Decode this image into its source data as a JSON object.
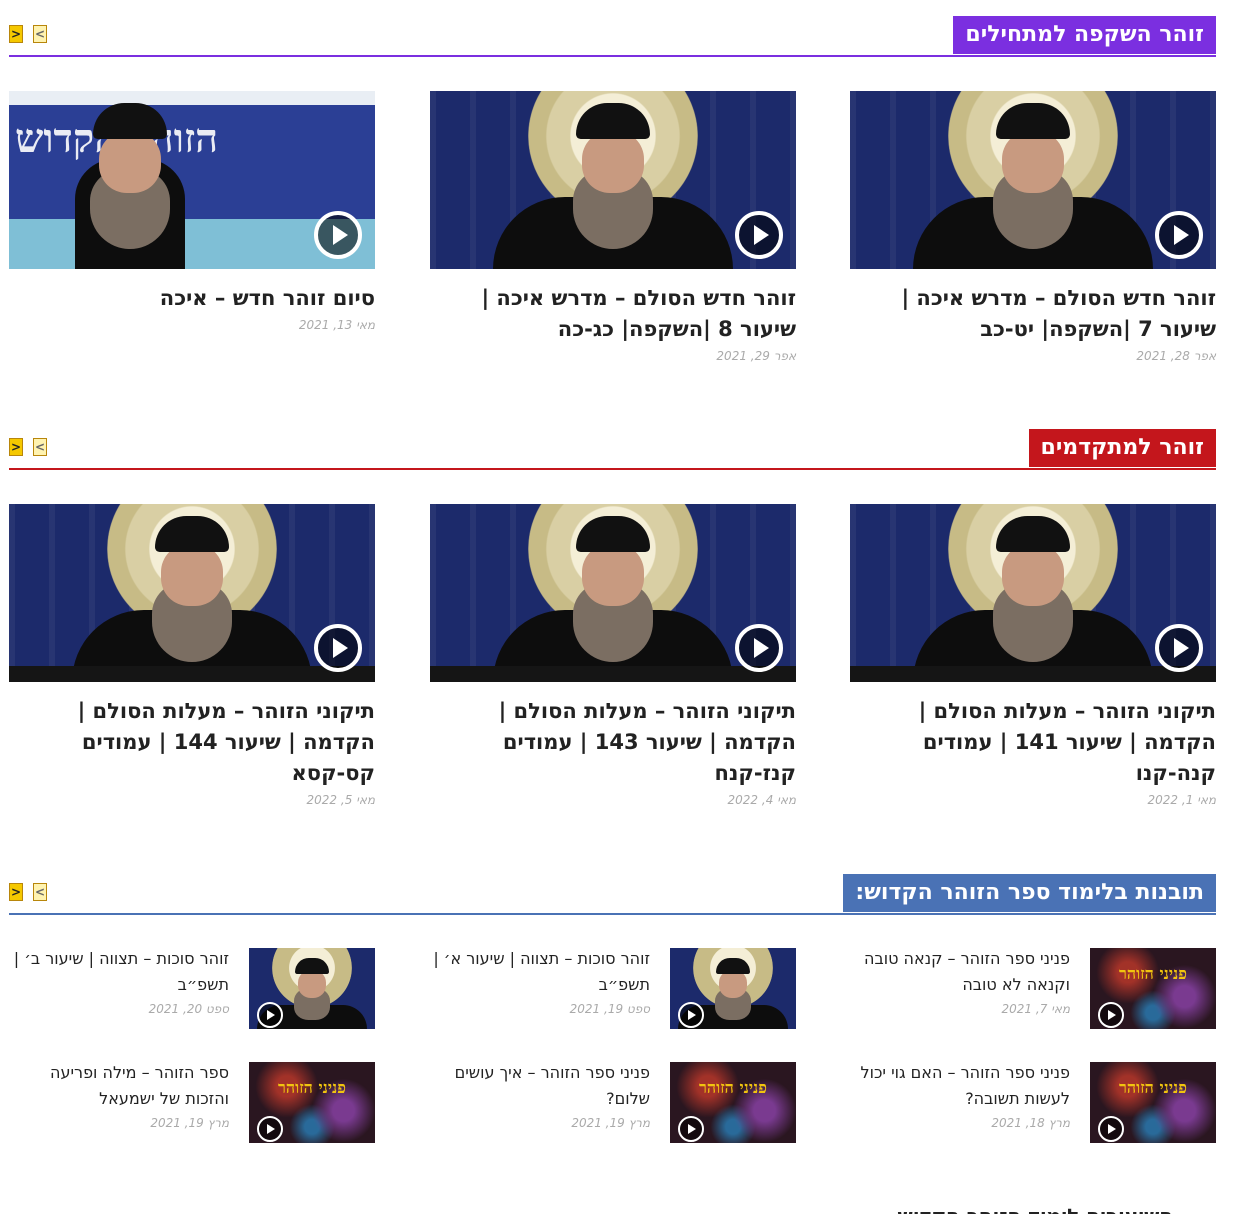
{
  "sections": [
    {
      "title": "זוהר השקפה למתחילים",
      "color": "#7b2fe0",
      "prev_icon": "chevron-left-icon",
      "next_icon": "chevron-right-icon",
      "cards": [
        {
          "title": "זוהר חדש הסולם – מדרש איכה | שיעור 7 |השקפה| יט-כב",
          "date": "אפר 28, 2021"
        },
        {
          "title": "זוהר חדש הסולם – מדרש איכה | שיעור 8 |השקפה| כג-כה",
          "date": "אפר 29, 2021"
        },
        {
          "title": "סיום זוהר חדש – איכה",
          "date": "מאי 13, 2021",
          "banner": "הזוהר הקדוש"
        }
      ]
    },
    {
      "title": "זוהר למתקדמים",
      "color": "#c4161c",
      "cards": [
        {
          "title": "תיקוני הזוהר – מעלות הסולם | הקדמה | שיעור 141 | עמודים קנה-קנו",
          "date": "מאי 1, 2022"
        },
        {
          "title": "תיקוני הזוהר – מעלות הסולם | הקדמה | שיעור 143 | עמודים קנז-קנח",
          "date": "מאי 4, 2022"
        },
        {
          "title": "תיקוני הזוהר – מעלות הסולם | הקדמה | שיעור 144 | עמודים קס-קסא",
          "date": "מאי 5, 2022"
        }
      ]
    },
    {
      "title": "תובנות בלימוד ספר הזוהר הקדוש:",
      "color": "#4a72b5",
      "items": [
        {
          "title": "פניני ספר הזוהר – קנאה טובה וקנאה לא טובה",
          "date": "מאי 7, 2021",
          "thumb": "brand",
          "brand": "פניני הזוהר"
        },
        {
          "title": "זוהר סוכות – תצווה | שיעור א׳ | תשפ״ב",
          "date": "ספט 19, 2021",
          "thumb": "portrait"
        },
        {
          "title": "זוהר סוכות – תצווה | שיעור ב׳ | תשפ״ב",
          "date": "ספט 20, 2021",
          "thumb": "portrait"
        },
        {
          "title": "פניני ספר הזוהר – האם גוי יכול לעשות תשובה?",
          "date": "מרץ 18, 2021",
          "thumb": "brand",
          "brand": "פניני הזוהר"
        },
        {
          "title": "פניני ספר הזוהר – איך עושים שלום?",
          "date": "מרץ 19, 2021",
          "thumb": "brand",
          "brand": "פניני הזוהר"
        },
        {
          "title": "ספר הזוהר – מילה ופריעה והזכות של ישמעאל",
          "date": "מרץ 19, 2021",
          "thumb": "brand",
          "brand": "פניני הזוהר"
        }
      ]
    }
  ],
  "next_heading": "השיעורים לימוד הזוהר הקדוש"
}
